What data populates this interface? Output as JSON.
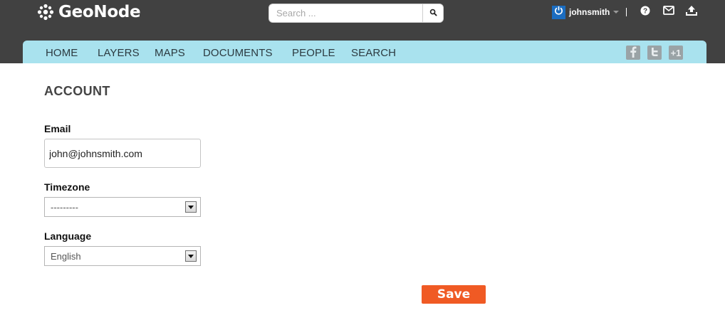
{
  "brand": {
    "name": "GeoNode"
  },
  "search": {
    "placeholder": "Search ..."
  },
  "user": {
    "name": "johnsmith"
  },
  "nav": {
    "items": [
      "HOME",
      "LAYERS",
      "MAPS",
      "DOCUMENTS",
      "PEOPLE",
      "SEARCH"
    ]
  },
  "social": {
    "gplus_label": "+1"
  },
  "page": {
    "title": "ACCOUNT"
  },
  "form": {
    "email_label": "Email",
    "email_value": "john@johnsmith.com",
    "timezone_label": "Timezone",
    "timezone_value": "---------",
    "language_label": "Language",
    "language_value": "English",
    "save_label": "Save"
  },
  "colors": {
    "topbar": "#414141",
    "navbar": "#a9e2ee",
    "save": "#f05a24",
    "avatar": "#1b6dc1"
  }
}
